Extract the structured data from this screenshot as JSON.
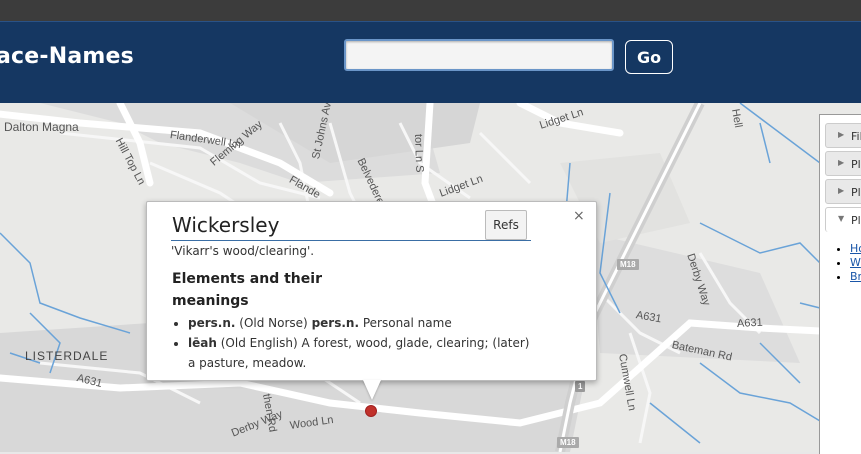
{
  "header": {
    "brand": "ace-Names",
    "search_placeholder": "",
    "go_label": "Go"
  },
  "map": {
    "labels": {
      "dalton_magna": "Dalton Magna",
      "hill_top_ln": "Hill Top Ln",
      "flanderwell_ln": "Flanderwell Ln",
      "fleming_way": "Fleming Way",
      "flanders": "Flande",
      "st_johns_ave": "St Johns Ave",
      "belvedere_parade": "Belvedere Parade",
      "tor_ln": "tor Ln S",
      "lidget_ln_1": "Lidget Ln",
      "lidget_ln_2": "Lidget Ln",
      "m18_1": "M18",
      "m18_2": "M18",
      "derby_way": "Derby Way",
      "a631_1": "A631",
      "a631_2": "A631",
      "a631_3": "A631",
      "bateman_rd": "Bateman Rd",
      "cumwell_ln": "Cumwell Ln",
      "listerdale": "LISTERDALE",
      "then_rd": "then Rd",
      "derby_way_2": "Derby Way",
      "wood_ln": "Wood Ln",
      "hell": "Hell",
      "one": "1"
    }
  },
  "popup": {
    "title": "Wickersley",
    "refs_label": "Refs",
    "close": "×",
    "meaning": "'Vikarr's wood/clearing'.",
    "elements_heading": "Elements and their meanings",
    "elements": [
      {
        "term": "pers.n.",
        "lang": "(Old Norse)",
        "term2": "pers.n.",
        "def": "Personal name"
      },
      {
        "term": "lēah",
        "lang": "(Old English)",
        "term2": "",
        "def": "A forest, wood, glade, clearing; (later) a pasture, meadow."
      }
    ]
  },
  "side_panel": {
    "tabs": [
      {
        "label": "Fil",
        "arrow": "▶"
      },
      {
        "label": "Pla",
        "arrow": "▶"
      },
      {
        "label": "Pla",
        "arrow": "▶"
      },
      {
        "label": "Pla",
        "arrow": "▼"
      }
    ],
    "links": [
      "Ho",
      "W",
      "Br"
    ]
  }
}
